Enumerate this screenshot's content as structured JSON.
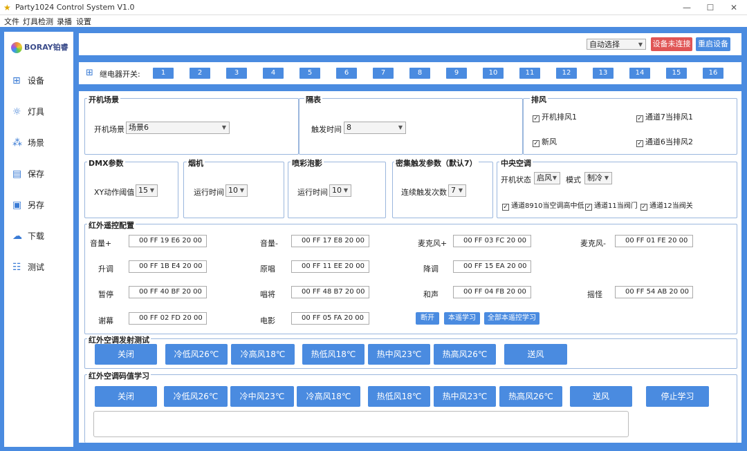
{
  "window": {
    "title": "Party1024 Control System V1.0"
  },
  "menu": [
    "文件",
    "灯具检测",
    "录播",
    "设置"
  ],
  "logo": "BORAY铂睿",
  "nav": [
    {
      "label": "设备",
      "icon": "device-icon",
      "glyph": "⊞"
    },
    {
      "label": "灯具",
      "icon": "lightbulb-icon",
      "glyph": "☼"
    },
    {
      "label": "场景",
      "icon": "scene-icon",
      "glyph": "⁂"
    },
    {
      "label": "保存",
      "icon": "save-icon",
      "glyph": "▤"
    },
    {
      "label": "另存",
      "icon": "save-as-icon",
      "glyph": "▣"
    },
    {
      "label": "下载",
      "icon": "cloud-download-icon",
      "glyph": "☁"
    },
    {
      "label": "测试",
      "icon": "test-icon",
      "glyph": "☷"
    }
  ],
  "top": {
    "mode_select": "自动选择",
    "connect_status": "设备未连接",
    "reset_button": "重启设备"
  },
  "relay": {
    "label": "继电器开关:",
    "buttons": [
      "1",
      "2",
      "3",
      "4",
      "5",
      "6",
      "7",
      "8",
      "9",
      "10",
      "11",
      "12",
      "13",
      "14",
      "15",
      "16"
    ]
  },
  "startup": {
    "title": "开机场景",
    "label": "开机场景",
    "value": "场景6"
  },
  "delay": {
    "title": "隔表",
    "label": "触发时间",
    "value": "8"
  },
  "exhaust": {
    "title": "排风",
    "items": [
      "开机排风1",
      "通道7当排风1",
      "新风",
      "通道6当排风2"
    ]
  },
  "dmx": {
    "title": "DMX参数",
    "label": "XY动作阈值",
    "value": "15"
  },
  "smoke": {
    "title": "烟机",
    "label": "运行时间",
    "value": "10"
  },
  "bubble": {
    "title": "喷彩泡影",
    "label": "运行时间",
    "value": "10"
  },
  "dense": {
    "title": "密集触发参数（默认7）",
    "label": "连续触发次数",
    "value": "7"
  },
  "ac": {
    "title": "中央空调",
    "power_label": "开机状态",
    "power_value": "启风",
    "mode_label": "模式",
    "mode_value": "制冷",
    "checks": [
      "通道8910当空调高中低",
      "通道11当阀门",
      "通道12当阀关"
    ]
  },
  "ir": {
    "title": "红外遥控配置",
    "rows": [
      [
        {
          "label": "音量+",
          "code": "00 FF 19 E6 20 00"
        },
        {
          "label": "音量-",
          "code": "00 FF 17 E8 20 00"
        },
        {
          "label": "麦克风+",
          "code": "00 FF 03 FC 20 00"
        },
        {
          "label": "麦克风-",
          "code": "00 FF 01 FE 20 00"
        }
      ],
      [
        {
          "label": "升调",
          "code": "00 FF 1B E4 20 00"
        },
        {
          "label": "原唱",
          "code": "00 FF 11 EE 20 00"
        },
        {
          "label": "降调",
          "code": "00 FF 15 EA 20 00"
        }
      ],
      [
        {
          "label": "暂停",
          "code": "00 FF 40 BF 20 00"
        },
        {
          "label": "唱将",
          "code": "00 FF 48 B7 20 00"
        },
        {
          "label": "和声",
          "code": "00 FF 04 FB 20 00"
        },
        {
          "label": "摇怪",
          "code": "00 FF 54 AB 20 00"
        }
      ],
      [
        {
          "label": "谢幕",
          "code": "00 FF 02 FD 20 00"
        },
        {
          "label": "电影",
          "code": "00 FF 05 FA 20 00"
        }
      ]
    ],
    "buttons": [
      "断开",
      "本遥学习",
      "全部本遥控学习"
    ]
  },
  "ac_test": {
    "title": "红外空调发射测试",
    "buttons": [
      "关闭",
      "冷低风26℃",
      "冷高风18℃",
      "热低风18℃",
      "热中风23℃",
      "热高风26℃",
      "送风"
    ]
  },
  "ac_learn": {
    "title": "红外空调码值学习",
    "buttons": [
      "关闭",
      "冷低风26℃",
      "冷中风23℃",
      "冷高风18℃",
      "热低风18℃",
      "热中风23℃",
      "热高风26℃",
      "送风",
      "停止学习"
    ]
  }
}
